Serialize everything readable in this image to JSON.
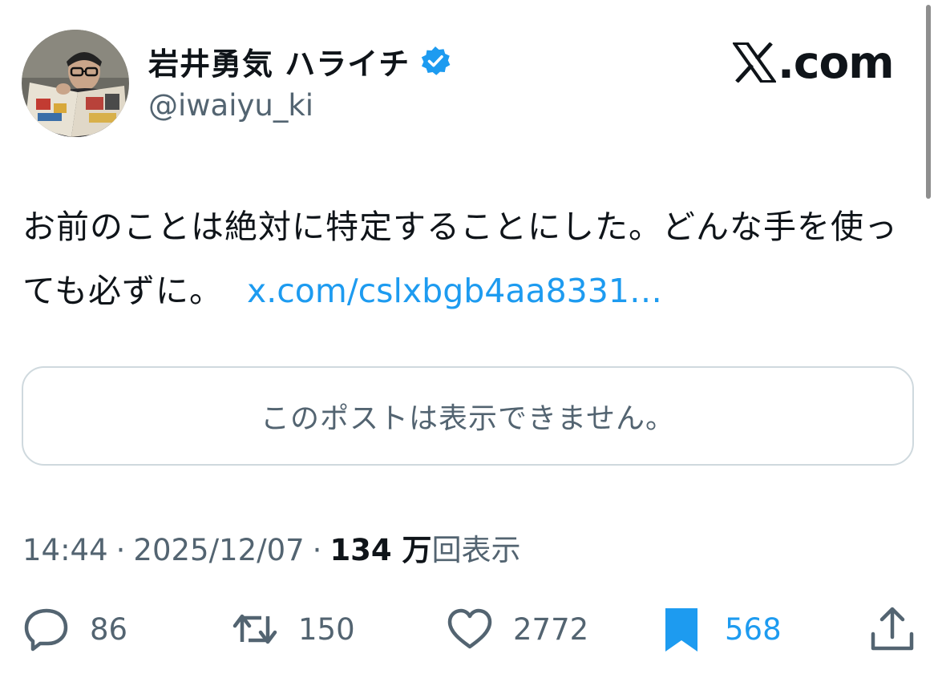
{
  "author": {
    "display_name": "岩井勇気 ハライチ",
    "handle": "@iwaiyu_ki",
    "verified": true,
    "avatar_icon": "avatar-photo"
  },
  "brand": {
    "logo_icon": "x-logo-icon",
    "domain_suffix": ".com"
  },
  "tweet": {
    "text": "お前のことは絶対に特定することにした。どんな手を使っても必ずに。",
    "link": "x.com/cslxbgb4aa8331…"
  },
  "quoted_post": {
    "unavailable_text": "このポストは表示できません。"
  },
  "meta": {
    "time": "14:44",
    "separator": "·",
    "date": "2025/12/07",
    "views_count": "134 万",
    "views_label": "回表示"
  },
  "actions": {
    "replies": "86",
    "reposts": "150",
    "likes": "2772",
    "bookmarks": "568",
    "bookmarked": true
  },
  "colors": {
    "text": "#0f1419",
    "secondary": "#536471",
    "accent": "#1d9bf0",
    "border": "#cfd9de"
  }
}
